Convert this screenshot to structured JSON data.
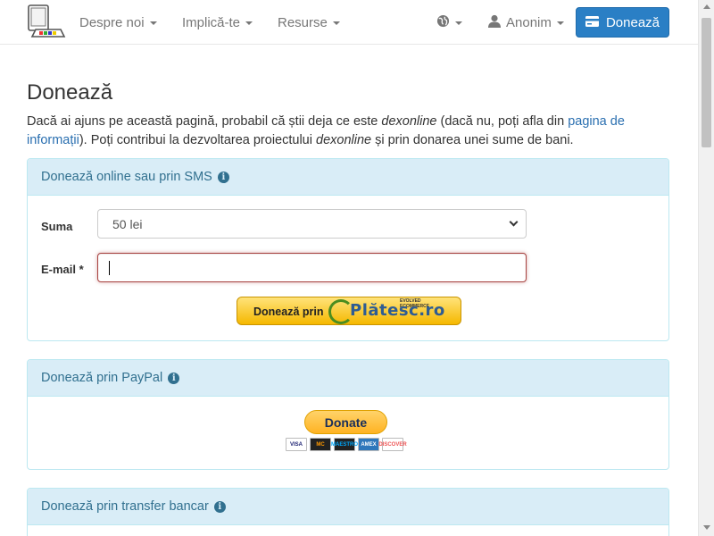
{
  "nav": {
    "about": "Despre noi",
    "involve": "Implică-te",
    "resources": "Resurse",
    "user": "Anonim",
    "donate": "Donează"
  },
  "page": {
    "title": "Donează",
    "intro_1": "Dacă ai ajuns pe această pagină, probabil că știi deja ce este ",
    "intro_em1": "dexonline",
    "intro_2": " (dacă nu, poți afla din ",
    "intro_link": "pagina de informații",
    "intro_3": "). Poți contribui la dezvoltarea proiectului ",
    "intro_em2": "dexonline",
    "intro_4": " și prin donarea unei sume de bani."
  },
  "panel_online": {
    "heading": "Donează online sau prin SMS",
    "amount_label": "Suma",
    "amount_value": "50 lei",
    "email_label": "E-mail *",
    "email_value": "",
    "button_text": "Donează prin",
    "brand_text": "Plătesc.ro",
    "brand_tag": "EVOLVED ECOMMERCE"
  },
  "panel_paypal": {
    "heading": "Donează prin PayPal",
    "button_text": "Donate",
    "cards": [
      "VISA",
      "MC",
      "MAESTRO",
      "AMEX",
      "DISCOVER"
    ]
  },
  "panel_bank": {
    "heading": "Donează prin transfer bancar"
  },
  "colors": {
    "primary": "#2a7fc5",
    "panel_heading_bg": "#d9edf7",
    "panel_border": "#bce8f1",
    "panel_text": "#31708f",
    "error_border": "#a94442"
  },
  "icons": {
    "logo": "computer-book-logo",
    "globe": "globe-icon",
    "user": "user-icon",
    "card": "credit-card-icon",
    "info": "info-circle-icon"
  }
}
